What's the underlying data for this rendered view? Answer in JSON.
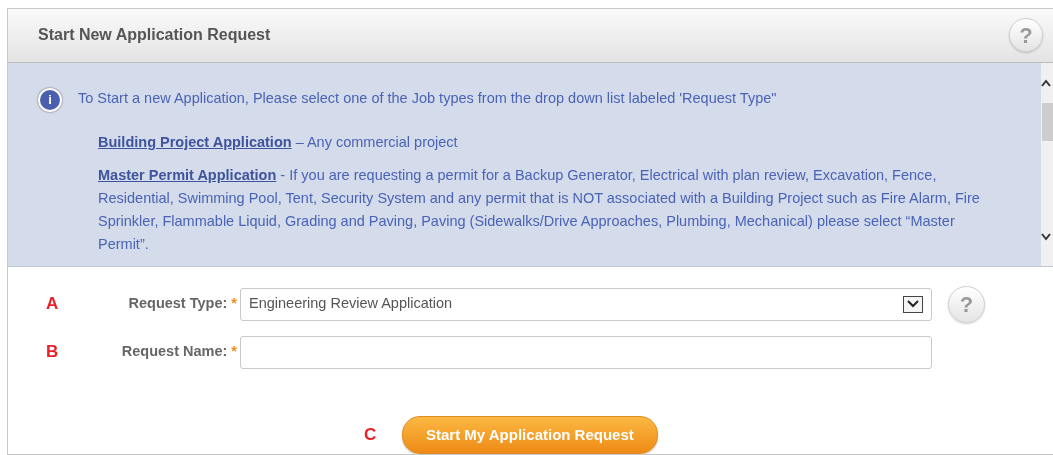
{
  "panel": {
    "title": "Start New Application Request",
    "help_icon": "?"
  },
  "info": {
    "icon": "i",
    "intro": "To Start a new Application, Please select one of the Job types from the drop down list labeled 'Request Type\"",
    "items": [
      {
        "link": "Building Project Application",
        "text": " – Any commercial project"
      },
      {
        "link": "Master Permit Application",
        "text": " - If you are requesting a permit for a Backup Generator, Electrical with plan review, Excavation, Fence, Residential, Swimming Pool, Tent, Security System and any permit that is NOT associated with a Building Project such as Fire Alarm, Fire Sprinkler, Flammable Liquid, Grading and Paving, Paving (Sidewalks/Drive Approaches, Plumbing, Mechanical) please select “Master Permit”."
      }
    ]
  },
  "form": {
    "fields": [
      {
        "marker": "A",
        "kind": "select",
        "label": "Request Type:",
        "required": "*",
        "value": "Engineering Review Application",
        "help": "?"
      },
      {
        "marker": "B",
        "kind": "text",
        "label": "Request Name:",
        "required": "*"
      }
    ],
    "submit": {
      "marker": "C",
      "label": "Start My Application Request"
    }
  }
}
